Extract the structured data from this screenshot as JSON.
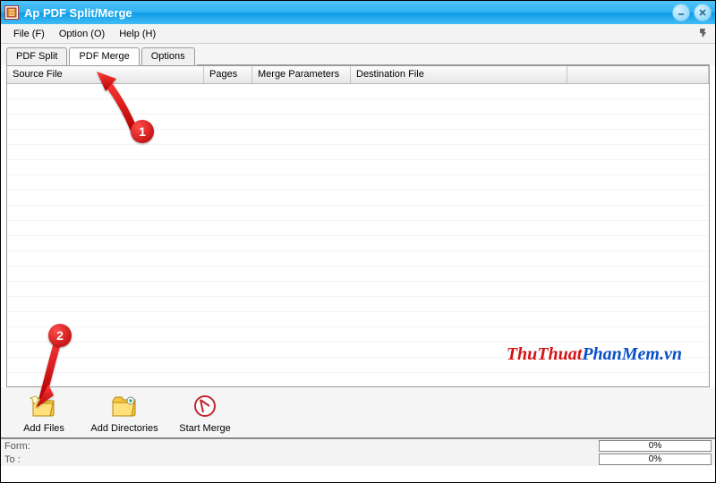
{
  "window": {
    "title": "Ap PDF Split/Merge"
  },
  "menu": {
    "file": "File (F)",
    "option": "Option (O)",
    "help": "Help (H)"
  },
  "tabs": {
    "split": "PDF Split",
    "merge": "PDF Merge",
    "options": "Options",
    "active": "merge"
  },
  "columns": {
    "source_file": "Source File",
    "pages": "Pages",
    "merge_params": "Merge Parameters",
    "dest_file": "Destination File"
  },
  "toolbar": {
    "add_files": "Add Files",
    "add_dirs": "Add Directories",
    "start_merge": "Start Merge"
  },
  "status": {
    "form_label": "Form:",
    "to_label": "To :",
    "progress1": "0%",
    "progress2": "0%"
  },
  "watermark": {
    "part1": "ThuThuat",
    "part2": "PhanMem",
    "part3": ".vn"
  },
  "annotations": {
    "badge1": "1",
    "badge2": "2"
  }
}
